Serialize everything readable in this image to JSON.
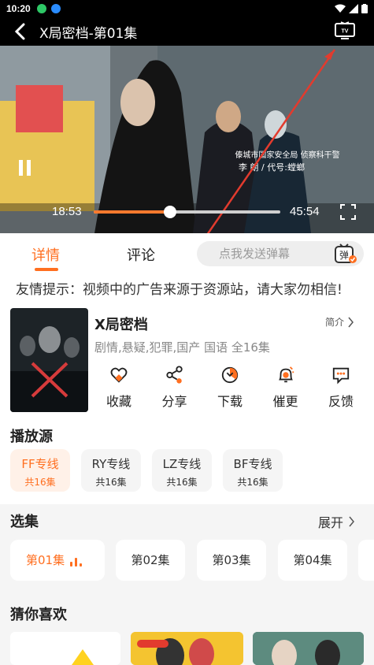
{
  "status_bar": {
    "time": "10:20"
  },
  "header": {
    "title": "X局密档-第01集"
  },
  "player": {
    "current_time": "18:53",
    "total_time": "45:54",
    "progress": 0.41
  },
  "tabs": {
    "details": "详情",
    "comments": "评论",
    "danmaku_placeholder": "点我发送弹幕",
    "danmaku_button": "弹"
  },
  "notice": "友情提示：视频中的广告来源于资源站，请大家勿相信!",
  "show": {
    "title": "X局密档",
    "intro": "简介",
    "meta": "剧情,悬疑,犯罪,国产 国语 全16集",
    "actions": [
      {
        "label": "收藏",
        "icon": "heart-icon"
      },
      {
        "label": "分享",
        "icon": "share-icon"
      },
      {
        "label": "下载",
        "icon": "download-icon"
      },
      {
        "label": "催更",
        "icon": "bell-icon"
      },
      {
        "label": "反馈",
        "icon": "feedback-icon"
      }
    ]
  },
  "sources": {
    "title": "播放源",
    "items": [
      {
        "name": "FF专线",
        "count": "共16集"
      },
      {
        "name": "RY专线",
        "count": "共16集"
      },
      {
        "name": "LZ专线",
        "count": "共16集"
      },
      {
        "name": "BF专线",
        "count": "共16集"
      }
    ]
  },
  "episodes": {
    "title": "选集",
    "expand": "展开",
    "items": [
      "第01集",
      "第02集",
      "第03集",
      "第04集"
    ]
  },
  "recommend": {
    "title": "猜你喜欢"
  },
  "colors": {
    "accent": "#ff6f20",
    "bg": "#f5f5f5"
  }
}
